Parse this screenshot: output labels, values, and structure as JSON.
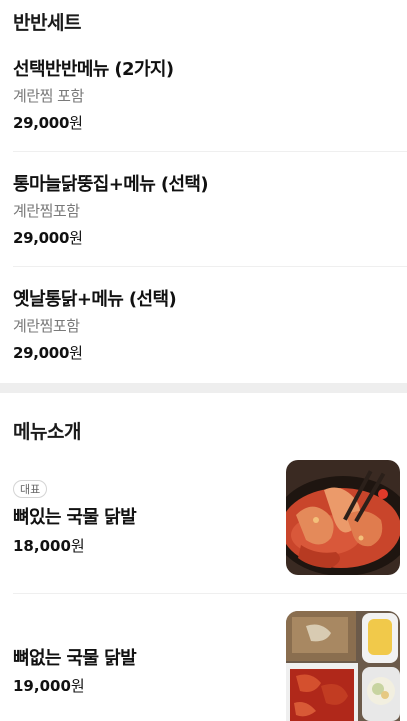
{
  "set_section": {
    "title": "반반세트",
    "items": [
      {
        "name": "선택반반메뉴 (2가지)",
        "desc": "계란찜 포함",
        "price": "29,000",
        "currency": "원"
      },
      {
        "name": "통마늘닭뚱집+메뉴 (선택)",
        "desc": "계란찜포함",
        "price": "29,000",
        "currency": "원"
      },
      {
        "name": "옛날통닭+메뉴 (선택)",
        "desc": "계란찜포함",
        "price": "29,000",
        "currency": "원"
      }
    ]
  },
  "menu_section": {
    "title": "메뉴소개",
    "items": [
      {
        "badge": "대표",
        "name": "뼈있는 국물 닭발",
        "price": "18,000",
        "currency": "원",
        "image": "chicken-feet-soup-photo"
      },
      {
        "name": "뼈없는 국물 닭발",
        "price": "19,000",
        "currency": "원",
        "image": "boneless-chicken-feet-set-photo"
      }
    ]
  }
}
